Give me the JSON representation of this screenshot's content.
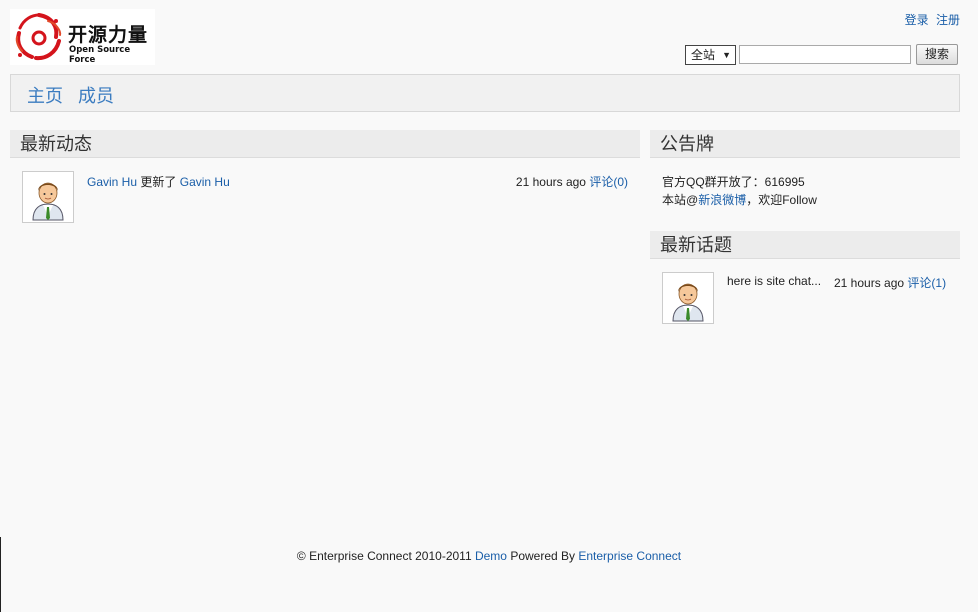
{
  "header": {
    "logo_cn": "开源力量",
    "logo_en": "Open Source Force",
    "login": "登录",
    "register": "注册"
  },
  "search": {
    "scope_value": "全站",
    "placeholder": "",
    "button_label": "搜索"
  },
  "nav": {
    "items": [
      {
        "label": "主页"
      },
      {
        "label": "成员"
      }
    ]
  },
  "activity": {
    "title": "最新动态",
    "items": [
      {
        "actor": "Gavin Hu",
        "verb": "更新了",
        "target": "Gavin Hu",
        "time": "21 hours ago",
        "comments": "评论(0)"
      }
    ]
  },
  "notice": {
    "title": "公告牌",
    "line1": "官方QQ群开放了：616995",
    "line2_prefix": "本站@",
    "line2_link": "新浪微博",
    "line2_suffix": "，欢迎Follow"
  },
  "topics": {
    "title": "最新话题",
    "items": [
      {
        "text": "here is site chat...",
        "time": "21 hours ago",
        "comments": "评论(1)"
      }
    ]
  },
  "footer": {
    "copyright": "© Enterprise Connect 2010-2011",
    "demo_link": "Demo",
    "powered_by": "Powered By",
    "ec_link": "Enterprise Connect"
  },
  "colors": {
    "link": "#1a5ea8",
    "nav_link": "#3b7cc0",
    "logo_red": "#d4141c"
  }
}
